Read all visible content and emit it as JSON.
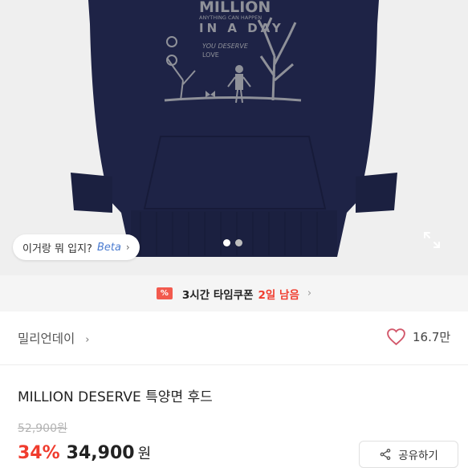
{
  "hero": {
    "chip_text": "이거랑 뭐 입지?",
    "chip_beta": "Beta",
    "chip_chevron": "›",
    "artwork_text": {
      "headline": "MILLION",
      "tagline": "ANYTHING CAN HAPPEN",
      "subline": "IN A DAY",
      "you_deserve": "YOU DESERVE",
      "love": "LOVE"
    },
    "carousel": {
      "count": 2,
      "active_index": 0
    }
  },
  "coupon": {
    "time_label": "3시간 타임쿠폰",
    "remaining": "2일 남음",
    "arrow": "›"
  },
  "brand": {
    "name": "밀리언데이",
    "chevron": "›",
    "likes": "16.7만"
  },
  "product": {
    "title": "MILLION DESERVE 특양면 후드",
    "original_price": "52,900원",
    "discount": "34%",
    "price": "34,900",
    "currency": "원"
  },
  "actions": {
    "share_label": "공유하기"
  },
  "colors": {
    "hoodie": "#1e2346",
    "print": "#8f9199",
    "accent_red": "#f03c2e",
    "beta_blue": "#4a7bd0"
  }
}
